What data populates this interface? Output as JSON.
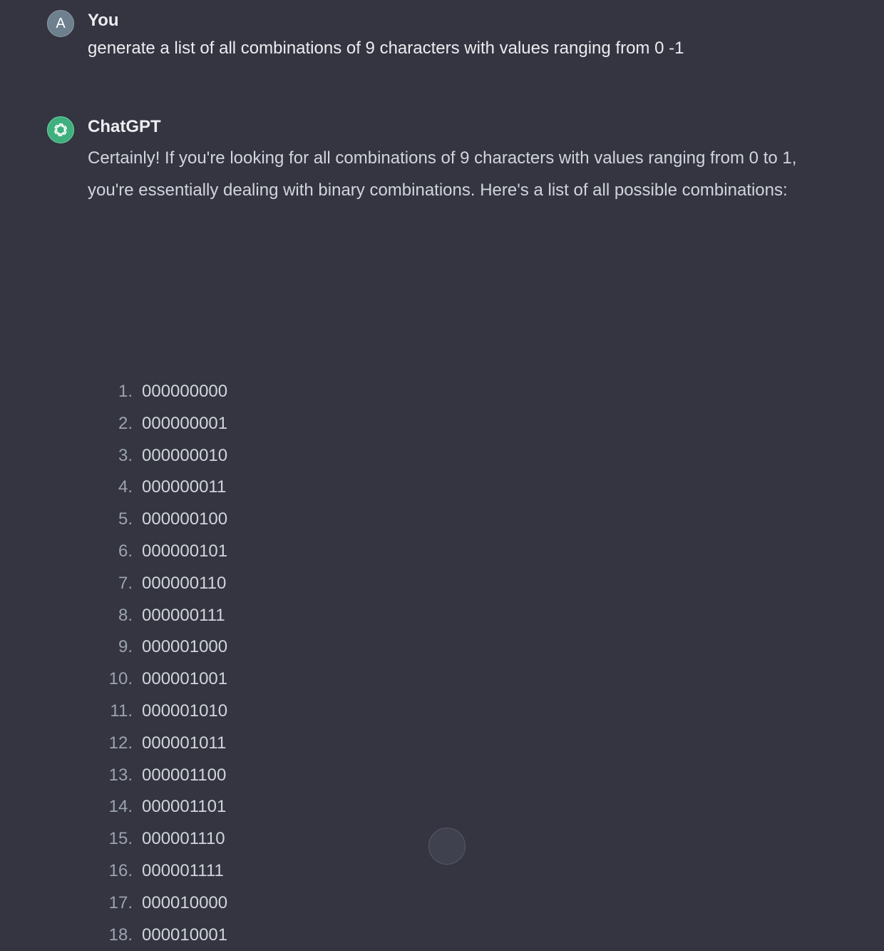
{
  "user_message": {
    "avatar_letter": "A",
    "author": "You",
    "text": "generate a list of all combinations of 9 characters with values ranging from  0 -1"
  },
  "assistant_message": {
    "avatar_icon": "openai-logo-icon",
    "author": "ChatGPT",
    "intro": "Certainly! If you're looking for all combinations of 9 characters with values ranging from 0 to 1, you're essentially dealing with binary combinations. Here's a list of all possible combinations:",
    "combinations": [
      {
        "num": "1.",
        "value": "000000000"
      },
      {
        "num": "2.",
        "value": "000000001"
      },
      {
        "num": "3.",
        "value": "000000010"
      },
      {
        "num": "4.",
        "value": "000000011"
      },
      {
        "num": "5.",
        "value": "000000100"
      },
      {
        "num": "6.",
        "value": "000000101"
      },
      {
        "num": "7.",
        "value": "000000110"
      },
      {
        "num": "8.",
        "value": "000000111"
      },
      {
        "num": "9.",
        "value": "000001000"
      },
      {
        "num": "10.",
        "value": "000001001"
      },
      {
        "num": "11.",
        "value": "000001010"
      },
      {
        "num": "12.",
        "value": "000001011"
      },
      {
        "num": "13.",
        "value": "000001100"
      },
      {
        "num": "14.",
        "value": "000001101"
      },
      {
        "num": "15.",
        "value": "000001110"
      },
      {
        "num": "16.",
        "value": "000001111"
      },
      {
        "num": "17.",
        "value": "000010000"
      },
      {
        "num": "18.",
        "value": "000010001"
      }
    ]
  },
  "colors": {
    "background": "#343541",
    "text": "#ececf1",
    "muted_text": "#9ca3af",
    "user_avatar": "#6e7f8d",
    "bot_avatar": "#3fb07d"
  }
}
